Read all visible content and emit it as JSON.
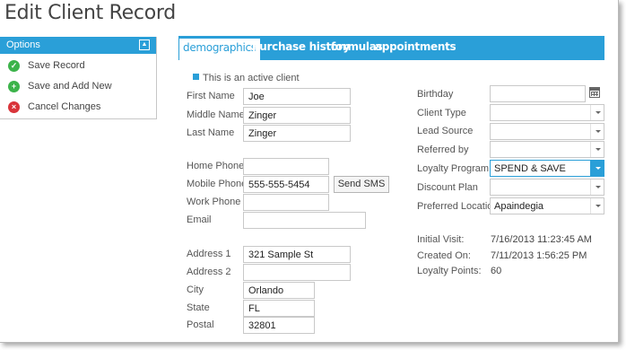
{
  "title": "Edit Client Record",
  "options": {
    "header": "Options",
    "collapse_icon": "▲",
    "items": [
      {
        "label": "Save Record",
        "icon": "check-circle"
      },
      {
        "label": "Save and Add New",
        "icon": "plus-circle"
      },
      {
        "label": "Cancel Changes",
        "icon": "x-circle"
      }
    ]
  },
  "tabs": [
    "demographics",
    "purchase history",
    "formulas",
    "appointments"
  ],
  "active_tab": "demographics",
  "active_client_label": "This is an active client",
  "fields": {
    "first_name": {
      "label": "First Name",
      "value": "Joe"
    },
    "middle_name": {
      "label": "Middle Name",
      "value": "Zinger"
    },
    "last_name": {
      "label": "Last Name",
      "value": "Zinger"
    },
    "home_phone": {
      "label": "Home Phone",
      "value": ""
    },
    "mobile_phone": {
      "label": "Mobile Phone",
      "value": "555-555-5454"
    },
    "work_phone": {
      "label": "Work Phone",
      "value": ""
    },
    "email": {
      "label": "Email",
      "value": ""
    },
    "address1": {
      "label": "Address 1",
      "value": "321 Sample St"
    },
    "address2": {
      "label": "Address 2",
      "value": ""
    },
    "city": {
      "label": "City",
      "value": "Orlando"
    },
    "state": {
      "label": "State",
      "value": "FL"
    },
    "postal": {
      "label": "Postal",
      "value": "32801"
    }
  },
  "send_sms_label": "Send SMS",
  "right": {
    "birthday": {
      "label": "Birthday",
      "value": ""
    },
    "client_type": {
      "label": "Client Type",
      "value": ""
    },
    "lead_source": {
      "label": "Lead Source",
      "value": ""
    },
    "referred_by": {
      "label": "Referred by",
      "value": ""
    },
    "loyalty_program": {
      "label": "Loyalty Program",
      "value": "SPEND & SAVE"
    },
    "discount_plan": {
      "label": "Discount Plan",
      "value": ""
    },
    "preferred_location": {
      "label": "Preferred Location",
      "value": "Apaindegia"
    }
  },
  "info": {
    "initial_visit": {
      "label": "Initial Visit:",
      "value": "7/16/2013 11:23:45 AM"
    },
    "created_on": {
      "label": "Created On:",
      "value": "7/11/2013 1:56:25 PM"
    },
    "loyalty_points": {
      "label": "Loyalty Points:",
      "value": "60"
    }
  },
  "colors": {
    "accent": "#2a9fd8",
    "success": "#3cb34a",
    "danger": "#d9343a"
  }
}
